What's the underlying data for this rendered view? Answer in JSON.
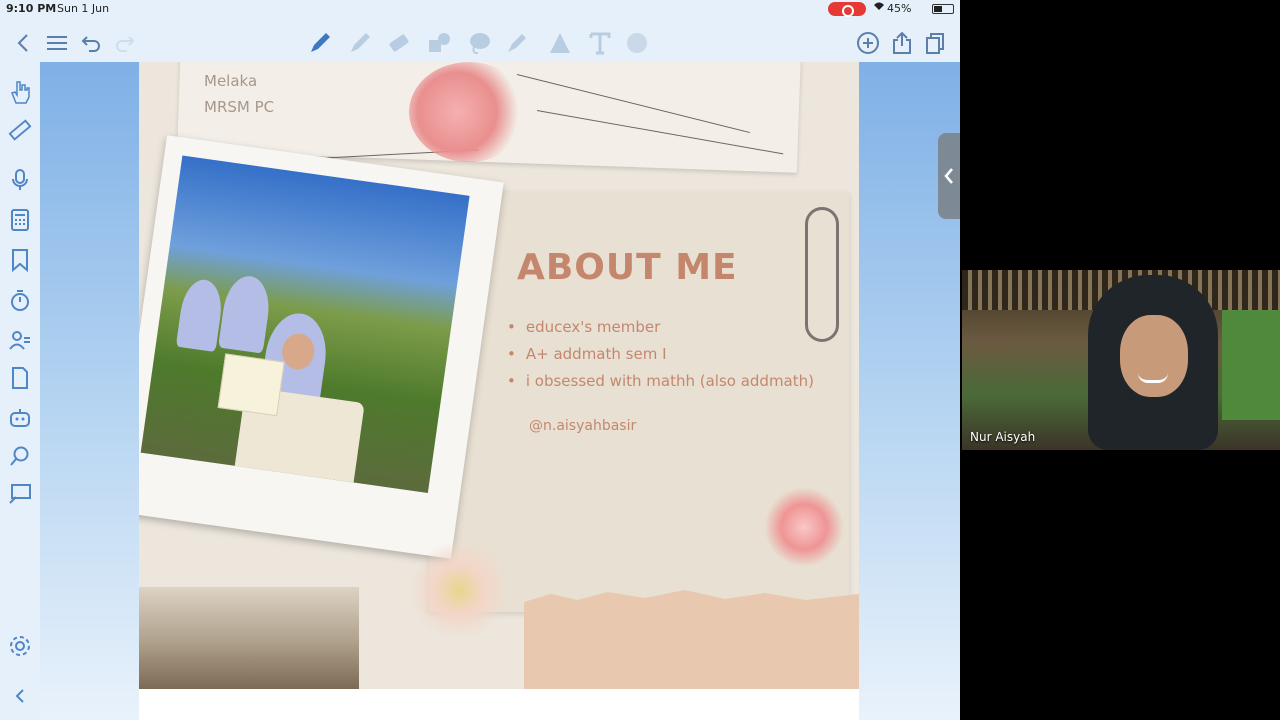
{
  "status": {
    "time": "9:10 PM",
    "date": "Sun 1 Jun",
    "battery": "45%"
  },
  "toolbar": {
    "left": [
      "chevron-left-icon",
      "menu-icon",
      "undo-icon",
      "redo-icon"
    ],
    "tools": [
      "pen-icon",
      "pencil-icon",
      "eraser-icon",
      "shapes-icon",
      "lasso-icon",
      "highlighter-icon",
      "triangle-icon",
      "text-icon",
      "color-icon"
    ],
    "right": [
      "add-icon",
      "share-icon",
      "pages-icon"
    ]
  },
  "sidebar": [
    "hand-icon",
    "ruler-icon",
    "mic-icon",
    "calculator-icon",
    "bookmark-icon",
    "timer-icon",
    "contacts-icon",
    "document-icon",
    "robot-icon",
    "search-icon",
    "presentation-icon",
    "settings-icon",
    "collapse-icon"
  ],
  "slide": {
    "place_line1": "Melaka",
    "place_line2": "MRSM PC",
    "title": "ABOUT ME",
    "bullets": [
      "educex's member",
      "A+ addmath sem I",
      "i obsessed with mathh (also addmath)"
    ],
    "handle": "@n.aisyahbasir"
  },
  "video": {
    "participant_name": "Nur Aisyah"
  },
  "colors": {
    "accent": "#3d78c0",
    "title": "#c4876e",
    "record": "#e53935"
  }
}
